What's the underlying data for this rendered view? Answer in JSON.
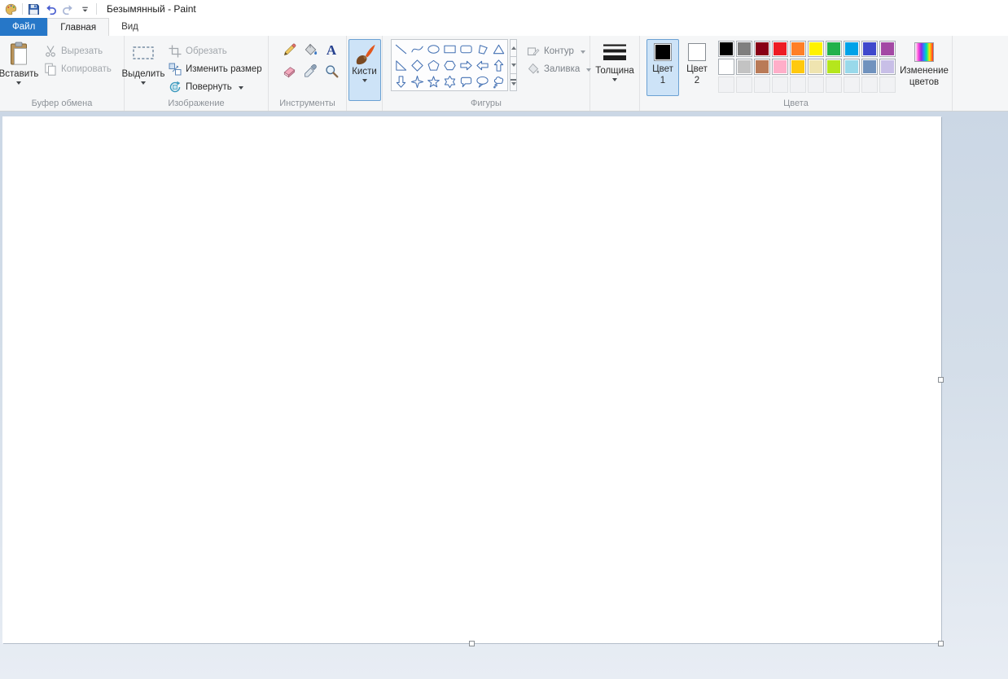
{
  "window": {
    "title": "Безымянный - Paint"
  },
  "tabs": {
    "file": "Файл",
    "home": "Главная",
    "view": "Вид"
  },
  "ribbon": {
    "clipboard": {
      "group_label": "Буфер обмена",
      "paste": "Вставить",
      "cut": "Вырезать",
      "copy": "Копировать"
    },
    "image": {
      "group_label": "Изображение",
      "select": "Выделить",
      "crop": "Обрезать",
      "resize": "Изменить размер",
      "rotate": "Повернуть"
    },
    "tools": {
      "group_label": "Инструменты",
      "items": [
        "pencil",
        "fill",
        "text",
        "eraser",
        "color-picker",
        "magnifier"
      ]
    },
    "brushes": {
      "label": "Кисти"
    },
    "shapes": {
      "group_label": "Фигуры",
      "outline": "Контур",
      "fill": "Заливка",
      "items": [
        "line",
        "curve",
        "oval",
        "rectangle",
        "rounded-rectangle",
        "polygon",
        "triangle",
        "right-triangle",
        "diamond",
        "pentagon",
        "hexagon",
        "right-arrow",
        "left-arrow",
        "up-arrow",
        "down-arrow",
        "four-point-star",
        "five-point-star",
        "six-point-star",
        "rounded-callout",
        "oval-callout",
        "cloud-callout"
      ]
    },
    "size": {
      "label": "Толщина"
    },
    "colors": {
      "group_label": "Цвета",
      "color1_label": "Цвет 1",
      "color1_value": "#000000",
      "color2_label": "Цвет 2",
      "color2_value": "#ffffff",
      "edit_colors": "Изменение цветов",
      "palette_rows": [
        [
          "#000000",
          "#7f7f7f",
          "#880015",
          "#ed1c24",
          "#ff7f27",
          "#fff200",
          "#22b14c",
          "#00a2e8",
          "#3f48cc",
          "#a349a4"
        ],
        [
          "#ffffff",
          "#c3c3c3",
          "#b97a57",
          "#ffaec9",
          "#ffc90e",
          "#efe4b0",
          "#b5e61d",
          "#99d9ea",
          "#7092be",
          "#c8bfe7"
        ],
        [
          null,
          null,
          null,
          null,
          null,
          null,
          null,
          null,
          null,
          null
        ]
      ]
    }
  }
}
